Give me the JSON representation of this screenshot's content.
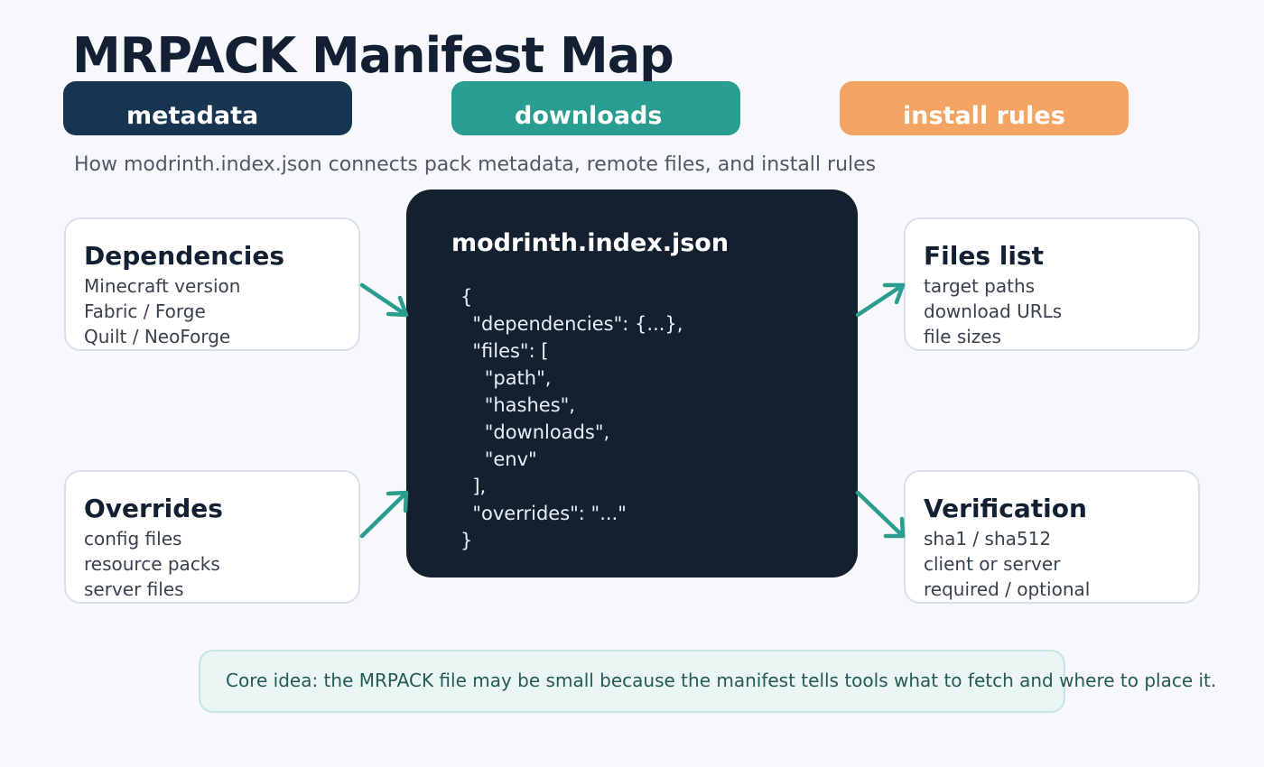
{
  "title": "MRPACK Manifest Map",
  "pills": {
    "metadata": "metadata",
    "downloads": "downloads",
    "install_rules": "install rules"
  },
  "subtitle": "How modrinth.index.json connects pack metadata, remote files, and install rules",
  "cards": {
    "dependencies": {
      "heading": "Dependencies",
      "lines": [
        "Minecraft version",
        "Fabric / Forge",
        "Quilt / NeoForge"
      ]
    },
    "overrides": {
      "heading": "Overrides",
      "lines": [
        "config files",
        "resource packs",
        "server files"
      ]
    },
    "files_list": {
      "heading": "Files list",
      "lines": [
        "target paths",
        "download URLs",
        "file sizes"
      ]
    },
    "verification": {
      "heading": "Verification",
      "lines": [
        "sha1 / sha512",
        "client or server",
        "required / optional"
      ]
    }
  },
  "code": {
    "title": "modrinth.index.json",
    "lines": [
      "{",
      "  \"dependencies\": {...},",
      "  \"files\": [",
      "    \"path\",",
      "    \"hashes\",",
      "    \"downloads\",",
      "    \"env\"",
      "  ],",
      "  \"overrides\": \"...\"",
      "}"
    ]
  },
  "note": "Core idea: the MRPACK file may be small because the manifest tells tools what to fetch and where to place it.",
  "colors": {
    "background": "#f6f8fb",
    "navy": "#173451",
    "teal": "#289d90",
    "orange": "#f3a463",
    "code_panel": "#13202f",
    "arrow": "#2a9d8f"
  }
}
